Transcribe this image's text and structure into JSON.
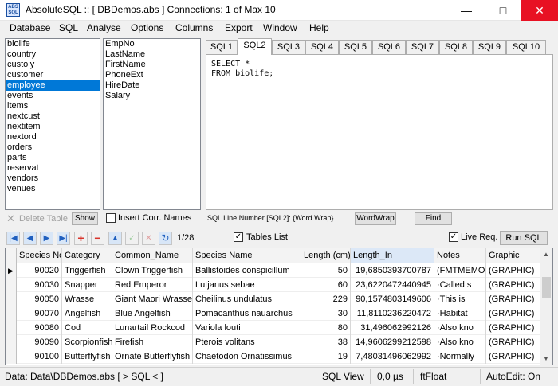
{
  "window": {
    "title": "AbsoluteSQL  ::  [ DBDemos.abs ]  Connections: 1 of Max 10",
    "icon_text": "ABS SQL",
    "minimize_glyph": "—",
    "maximize_glyph": "□",
    "close_glyph": "✕"
  },
  "menu": [
    "Database",
    "SQL",
    "Analyse",
    "Options",
    "Columns",
    "Export",
    "Window",
    "Help"
  ],
  "tables": {
    "items": [
      "biolife",
      "country",
      "custoly",
      "customer",
      "employee",
      "events",
      "items",
      "nextcust",
      "nextitem",
      "nextord",
      "orders",
      "parts",
      "reservat",
      "vendors",
      "venues"
    ],
    "selected": "employee"
  },
  "fields": [
    "EmpNo",
    "LastName",
    "FirstName",
    "PhoneExt",
    "HireDate",
    "Salary"
  ],
  "sql_tabs": {
    "labels": [
      "SQL1",
      "SQL2",
      "SQL3",
      "SQL4",
      "SQL5",
      "SQL6",
      "SQL7",
      "SQL8",
      "SQL9",
      "SQL10"
    ],
    "active": "SQL2"
  },
  "editor": {
    "line1": "SELECT *",
    "line2": "FROM biolife;"
  },
  "under_panel": {
    "delete_table": "Delete Table",
    "show": "Show",
    "insert_corr_names": "Insert Corr. Names",
    "sql_line_info": "SQL Line Number [SQL2]: {Word Wrap}",
    "wordwrap": "WordWrap",
    "find": "Find"
  },
  "navbar": {
    "counter": "1/28",
    "tables_list": "Tables List",
    "live_req": "Live Req.",
    "run_sql": "Run SQL",
    "glyphs": {
      "first": "|◀",
      "prev": "◀",
      "next": "▶",
      "last": "▶|",
      "add": "+",
      "remove": "−",
      "up": "▲",
      "post": "✓",
      "cancel": "✕",
      "refresh": "↻"
    }
  },
  "grid": {
    "columns": [
      "Species No",
      "Category",
      "Common_Name",
      "Species Name",
      "Length (cm)",
      "Length_In",
      "Notes",
      "Graphic"
    ],
    "rows": [
      [
        "90020",
        "Triggerfish",
        "Clown Triggerfish",
        "Ballistoides conspicillum",
        "50",
        "19,6850393700787",
        "(FMTMEMO)",
        "(GRAPHIC)"
      ],
      [
        "90030",
        "Snapper",
        "Red Emperor",
        "Lutjanus sebae",
        "60",
        "23,6220472440945",
        "·Called s",
        "(GRAPHIC)"
      ],
      [
        "90050",
        "Wrasse",
        "Giant Maori Wrasse",
        "Cheilinus undulatus",
        "229",
        "90,1574803149606",
        "·This is",
        "(GRAPHIC)"
      ],
      [
        "90070",
        "Angelfish",
        "Blue Angelfish",
        "Pomacanthus nauarchus",
        "30",
        "11,8110236220472",
        "·Habitat",
        "(GRAPHIC)"
      ],
      [
        "90080",
        "Cod",
        "Lunartail Rockcod",
        "Variola louti",
        "80",
        "31,496062992126",
        "·Also kno",
        "(GRAPHIC)"
      ],
      [
        "90090",
        "Scorpionfish",
        "Firefish",
        "Pterois volitans",
        "38",
        "14,9606299212598",
        "·Also kno",
        "(GRAPHIC)"
      ],
      [
        "90100",
        "Butterflyfish",
        "Ornate Butterflyfish",
        "Chaetodon Ornatissimus",
        "19",
        "7,48031496062992",
        "·Normally",
        "(GRAPHIC)"
      ]
    ]
  },
  "status": {
    "data": "Data: Data\\DBDemos.abs [ > SQL < ]",
    "view": "SQL View",
    "time": "0,0 µs",
    "type": "ftFloat",
    "autoedit": "AutoEdit: On"
  }
}
